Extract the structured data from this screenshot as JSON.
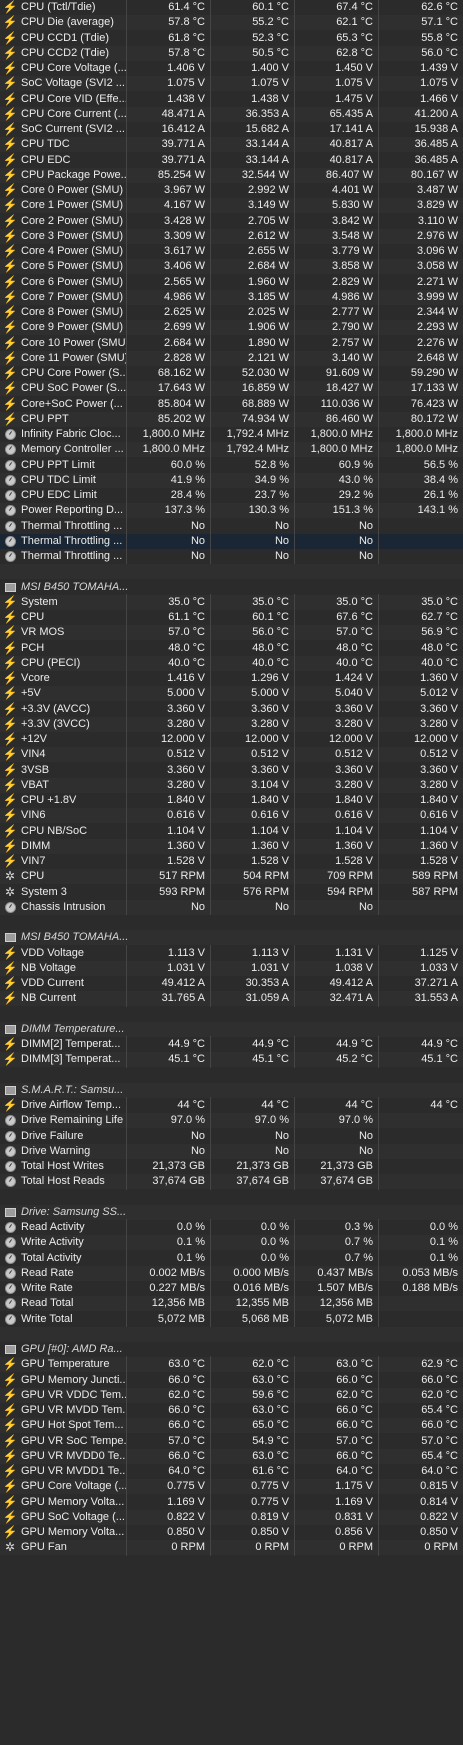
{
  "icons": {
    "bolt": "⚡",
    "fan": "✲"
  },
  "rows": [
    {
      "t": "s",
      "ic": "bolt",
      "n": "CPU (Tctl/Tdie)",
      "v": [
        "61.4 °C",
        "60.1 °C",
        "67.4 °C",
        "62.6 °C"
      ]
    },
    {
      "t": "s",
      "ic": "bolt",
      "n": "CPU Die (average)",
      "v": [
        "57.8 °C",
        "55.2 °C",
        "62.1 °C",
        "57.1 °C"
      ]
    },
    {
      "t": "s",
      "ic": "bolt",
      "n": "CPU CCD1 (Tdie)",
      "v": [
        "61.8 °C",
        "52.3 °C",
        "65.3 °C",
        "55.8 °C"
      ]
    },
    {
      "t": "s",
      "ic": "bolt",
      "n": "CPU CCD2 (Tdie)",
      "v": [
        "57.8 °C",
        "50.5 °C",
        "62.8 °C",
        "56.0 °C"
      ]
    },
    {
      "t": "s",
      "ic": "bolt",
      "n": "CPU Core Voltage (...",
      "v": [
        "1.406 V",
        "1.400 V",
        "1.450 V",
        "1.439 V"
      ]
    },
    {
      "t": "s",
      "ic": "bolt",
      "n": "SoC Voltage (SVI2 ...",
      "v": [
        "1.075 V",
        "1.075 V",
        "1.075 V",
        "1.075 V"
      ]
    },
    {
      "t": "s",
      "ic": "bolt",
      "n": "CPU Core VID (Effe...",
      "v": [
        "1.438 V",
        "1.438 V",
        "1.475 V",
        "1.466 V"
      ]
    },
    {
      "t": "s",
      "ic": "bolt",
      "n": "CPU Core Current (...",
      "v": [
        "48.471 A",
        "36.353 A",
        "65.435 A",
        "41.200 A"
      ]
    },
    {
      "t": "s",
      "ic": "bolt",
      "n": "SoC Current (SVI2 ...",
      "v": [
        "16.412 A",
        "15.682 A",
        "17.141 A",
        "15.938 A"
      ]
    },
    {
      "t": "s",
      "ic": "bolt",
      "n": "CPU TDC",
      "v": [
        "39.771 A",
        "33.144 A",
        "40.817 A",
        "36.485 A"
      ]
    },
    {
      "t": "s",
      "ic": "bolt",
      "n": "CPU EDC",
      "v": [
        "39.771 A",
        "33.144 A",
        "40.817 A",
        "36.485 A"
      ]
    },
    {
      "t": "s",
      "ic": "bolt",
      "n": "CPU Package Powe...",
      "v": [
        "85.254 W",
        "32.544 W",
        "86.407 W",
        "80.167 W"
      ]
    },
    {
      "t": "s",
      "ic": "bolt",
      "n": "Core 0 Power (SMU)",
      "v": [
        "3.967 W",
        "2.992 W",
        "4.401 W",
        "3.487 W"
      ]
    },
    {
      "t": "s",
      "ic": "bolt",
      "n": "Core 1 Power (SMU)",
      "v": [
        "4.167 W",
        "3.149 W",
        "5.830 W",
        "3.829 W"
      ]
    },
    {
      "t": "s",
      "ic": "bolt",
      "n": "Core 2 Power (SMU)",
      "v": [
        "3.428 W",
        "2.705 W",
        "3.842 W",
        "3.110 W"
      ]
    },
    {
      "t": "s",
      "ic": "bolt",
      "n": "Core 3 Power (SMU)",
      "v": [
        "3.309 W",
        "2.612 W",
        "3.548 W",
        "2.976 W"
      ]
    },
    {
      "t": "s",
      "ic": "bolt",
      "n": "Core 4 Power (SMU)",
      "v": [
        "3.617 W",
        "2.655 W",
        "3.779 W",
        "3.096 W"
      ]
    },
    {
      "t": "s",
      "ic": "bolt",
      "n": "Core 5 Power (SMU)",
      "v": [
        "3.406 W",
        "2.684 W",
        "3.858 W",
        "3.058 W"
      ]
    },
    {
      "t": "s",
      "ic": "bolt",
      "n": "Core 6 Power (SMU)",
      "v": [
        "2.565 W",
        "1.960 W",
        "2.829 W",
        "2.271 W"
      ]
    },
    {
      "t": "s",
      "ic": "bolt",
      "n": "Core 7 Power (SMU)",
      "v": [
        "4.986 W",
        "3.185 W",
        "4.986 W",
        "3.999 W"
      ]
    },
    {
      "t": "s",
      "ic": "bolt",
      "n": "Core 8 Power (SMU)",
      "v": [
        "2.625 W",
        "2.025 W",
        "2.777 W",
        "2.344 W"
      ]
    },
    {
      "t": "s",
      "ic": "bolt",
      "n": "Core 9 Power (SMU)",
      "v": [
        "2.699 W",
        "1.906 W",
        "2.790 W",
        "2.293 W"
      ]
    },
    {
      "t": "s",
      "ic": "bolt",
      "n": "Core 10 Power (SMU)",
      "v": [
        "2.684 W",
        "1.890 W",
        "2.757 W",
        "2.276 W"
      ]
    },
    {
      "t": "s",
      "ic": "bolt",
      "n": "Core 11 Power (SMU)",
      "v": [
        "2.828 W",
        "2.121 W",
        "3.140 W",
        "2.648 W"
      ]
    },
    {
      "t": "s",
      "ic": "bolt",
      "n": "CPU Core Power (S...",
      "v": [
        "68.162 W",
        "52.030 W",
        "91.609 W",
        "59.290 W"
      ]
    },
    {
      "t": "s",
      "ic": "bolt",
      "n": "CPU SoC Power (S...",
      "v": [
        "17.643 W",
        "16.859 W",
        "18.427 W",
        "17.133 W"
      ]
    },
    {
      "t": "s",
      "ic": "bolt",
      "n": "Core+SoC Power (...",
      "v": [
        "85.804 W",
        "68.889 W",
        "110.036 W",
        "76.423 W"
      ]
    },
    {
      "t": "s",
      "ic": "bolt",
      "n": "CPU PPT",
      "v": [
        "85.202 W",
        "74.934 W",
        "86.460 W",
        "80.172 W"
      ]
    },
    {
      "t": "s",
      "ic": "gauge",
      "n": "Infinity Fabric Cloc...",
      "v": [
        "1,800.0 MHz",
        "1,792.4 MHz",
        "1,800.0 MHz",
        "1,800.0 MHz"
      ]
    },
    {
      "t": "s",
      "ic": "gauge",
      "n": "Memory Controller ...",
      "v": [
        "1,800.0 MHz",
        "1,792.4 MHz",
        "1,800.0 MHz",
        "1,800.0 MHz"
      ]
    },
    {
      "t": "s",
      "ic": "gauge",
      "n": "CPU PPT Limit",
      "v": [
        "60.0 %",
        "52.8 %",
        "60.9 %",
        "56.5 %"
      ]
    },
    {
      "t": "s",
      "ic": "gauge",
      "n": "CPU TDC Limit",
      "v": [
        "41.9 %",
        "34.9 %",
        "43.0 %",
        "38.4 %"
      ]
    },
    {
      "t": "s",
      "ic": "gauge",
      "n": "CPU EDC Limit",
      "v": [
        "28.4 %",
        "23.7 %",
        "29.2 %",
        "26.1 %"
      ]
    },
    {
      "t": "s",
      "ic": "gauge",
      "n": "Power Reporting D...",
      "v": [
        "137.3 %",
        "130.3 %",
        "151.3 %",
        "143.1 %"
      ]
    },
    {
      "t": "s",
      "ic": "gauge",
      "n": "Thermal Throttling ...",
      "v": [
        "No",
        "No",
        "No",
        ""
      ]
    },
    {
      "t": "s",
      "ic": "gauge",
      "n": "Thermal Throttling ...",
      "v": [
        "No",
        "No",
        "No",
        ""
      ],
      "sel": true
    },
    {
      "t": "s",
      "ic": "gauge",
      "n": "Thermal Throttling ...",
      "v": [
        "No",
        "No",
        "No",
        ""
      ]
    },
    {
      "t": "b"
    },
    {
      "t": "h",
      "n": "MSI B450 TOMAHA..."
    },
    {
      "t": "s",
      "ic": "bolt",
      "n": "System",
      "v": [
        "35.0 °C",
        "35.0 °C",
        "35.0 °C",
        "35.0 °C"
      ]
    },
    {
      "t": "s",
      "ic": "bolt",
      "n": "CPU",
      "v": [
        "61.1 °C",
        "60.1 °C",
        "67.6 °C",
        "62.7 °C"
      ]
    },
    {
      "t": "s",
      "ic": "bolt",
      "n": "VR MOS",
      "v": [
        "57.0 °C",
        "56.0 °C",
        "57.0 °C",
        "56.9 °C"
      ]
    },
    {
      "t": "s",
      "ic": "bolt",
      "n": "PCH",
      "v": [
        "48.0 °C",
        "48.0 °C",
        "48.0 °C",
        "48.0 °C"
      ]
    },
    {
      "t": "s",
      "ic": "bolt",
      "n": "CPU (PECI)",
      "v": [
        "40.0 °C",
        "40.0 °C",
        "40.0 °C",
        "40.0 °C"
      ]
    },
    {
      "t": "s",
      "ic": "bolt",
      "n": "Vcore",
      "v": [
        "1.416 V",
        "1.296 V",
        "1.424 V",
        "1.360 V"
      ]
    },
    {
      "t": "s",
      "ic": "bolt",
      "n": "+5V",
      "v": [
        "5.000 V",
        "5.000 V",
        "5.040 V",
        "5.012 V"
      ]
    },
    {
      "t": "s",
      "ic": "bolt",
      "n": "+3.3V (AVCC)",
      "v": [
        "3.360 V",
        "3.360 V",
        "3.360 V",
        "3.360 V"
      ]
    },
    {
      "t": "s",
      "ic": "bolt",
      "n": "+3.3V (3VCC)",
      "v": [
        "3.280 V",
        "3.280 V",
        "3.280 V",
        "3.280 V"
      ]
    },
    {
      "t": "s",
      "ic": "bolt",
      "n": "+12V",
      "v": [
        "12.000 V",
        "12.000 V",
        "12.000 V",
        "12.000 V"
      ]
    },
    {
      "t": "s",
      "ic": "bolt",
      "n": "VIN4",
      "v": [
        "0.512 V",
        "0.512 V",
        "0.512 V",
        "0.512 V"
      ]
    },
    {
      "t": "s",
      "ic": "bolt",
      "n": "3VSB",
      "v": [
        "3.360 V",
        "3.360 V",
        "3.360 V",
        "3.360 V"
      ]
    },
    {
      "t": "s",
      "ic": "bolt",
      "n": "VBAT",
      "v": [
        "3.280 V",
        "3.104 V",
        "3.280 V",
        "3.280 V"
      ]
    },
    {
      "t": "s",
      "ic": "bolt",
      "n": "CPU +1.8V",
      "v": [
        "1.840 V",
        "1.840 V",
        "1.840 V",
        "1.840 V"
      ]
    },
    {
      "t": "s",
      "ic": "bolt",
      "n": "VIN6",
      "v": [
        "0.616 V",
        "0.616 V",
        "0.616 V",
        "0.616 V"
      ]
    },
    {
      "t": "s",
      "ic": "bolt",
      "n": "CPU NB/SoC",
      "v": [
        "1.104 V",
        "1.104 V",
        "1.104 V",
        "1.104 V"
      ]
    },
    {
      "t": "s",
      "ic": "bolt",
      "n": "DIMM",
      "v": [
        "1.360 V",
        "1.360 V",
        "1.360 V",
        "1.360 V"
      ]
    },
    {
      "t": "s",
      "ic": "bolt",
      "n": "VIN7",
      "v": [
        "1.528 V",
        "1.528 V",
        "1.528 V",
        "1.528 V"
      ]
    },
    {
      "t": "s",
      "ic": "fan",
      "n": "CPU",
      "v": [
        "517 RPM",
        "504 RPM",
        "709 RPM",
        "589 RPM"
      ]
    },
    {
      "t": "s",
      "ic": "fan",
      "n": "System 3",
      "v": [
        "593 RPM",
        "576 RPM",
        "594 RPM",
        "587 RPM"
      ]
    },
    {
      "t": "s",
      "ic": "gauge",
      "n": "Chassis Intrusion",
      "v": [
        "No",
        "No",
        "No",
        ""
      ]
    },
    {
      "t": "b"
    },
    {
      "t": "h",
      "n": "MSI B450 TOMAHA..."
    },
    {
      "t": "s",
      "ic": "bolt",
      "n": "VDD Voltage",
      "v": [
        "1.113 V",
        "1.113 V",
        "1.131 V",
        "1.125 V"
      ]
    },
    {
      "t": "s",
      "ic": "bolt",
      "n": "NB Voltage",
      "v": [
        "1.031 V",
        "1.031 V",
        "1.038 V",
        "1.033 V"
      ]
    },
    {
      "t": "s",
      "ic": "bolt",
      "n": "VDD Current",
      "v": [
        "49.412 A",
        "30.353 A",
        "49.412 A",
        "37.271 A"
      ]
    },
    {
      "t": "s",
      "ic": "bolt",
      "n": "NB Current",
      "v": [
        "31.765 A",
        "31.059 A",
        "32.471 A",
        "31.553 A"
      ]
    },
    {
      "t": "b"
    },
    {
      "t": "h",
      "n": "DIMM Temperature..."
    },
    {
      "t": "s",
      "ic": "bolt",
      "n": "DIMM[2] Temperat...",
      "v": [
        "44.9 °C",
        "44.9 °C",
        "44.9 °C",
        "44.9 °C"
      ]
    },
    {
      "t": "s",
      "ic": "bolt",
      "n": "DIMM[3] Temperat...",
      "v": [
        "45.1 °C",
        "45.1 °C",
        "45.2 °C",
        "45.1 °C"
      ]
    },
    {
      "t": "b"
    },
    {
      "t": "h",
      "n": "S.M.A.R.T.: Samsu..."
    },
    {
      "t": "s",
      "ic": "bolt",
      "n": "Drive Airflow Temp...",
      "v": [
        "44 °C",
        "44 °C",
        "44 °C",
        "44 °C"
      ]
    },
    {
      "t": "s",
      "ic": "gauge",
      "n": "Drive Remaining Life",
      "v": [
        "97.0 %",
        "97.0 %",
        "97.0 %",
        ""
      ]
    },
    {
      "t": "s",
      "ic": "gauge",
      "n": "Drive Failure",
      "v": [
        "No",
        "No",
        "No",
        ""
      ]
    },
    {
      "t": "s",
      "ic": "gauge",
      "n": "Drive Warning",
      "v": [
        "No",
        "No",
        "No",
        ""
      ]
    },
    {
      "t": "s",
      "ic": "gauge",
      "n": "Total Host Writes",
      "v": [
        "21,373 GB",
        "21,373 GB",
        "21,373 GB",
        ""
      ]
    },
    {
      "t": "s",
      "ic": "gauge",
      "n": "Total Host Reads",
      "v": [
        "37,674 GB",
        "37,674 GB",
        "37,674 GB",
        ""
      ]
    },
    {
      "t": "b"
    },
    {
      "t": "h",
      "n": "Drive: Samsung SS..."
    },
    {
      "t": "s",
      "ic": "gauge",
      "n": "Read Activity",
      "v": [
        "0.0 %",
        "0.0 %",
        "0.3 %",
        "0.0 %"
      ]
    },
    {
      "t": "s",
      "ic": "gauge",
      "n": "Write Activity",
      "v": [
        "0.1 %",
        "0.0 %",
        "0.7 %",
        "0.1 %"
      ]
    },
    {
      "t": "s",
      "ic": "gauge",
      "n": "Total Activity",
      "v": [
        "0.1 %",
        "0.0 %",
        "0.7 %",
        "0.1 %"
      ]
    },
    {
      "t": "s",
      "ic": "gauge",
      "n": "Read Rate",
      "v": [
        "0.002 MB/s",
        "0.000 MB/s",
        "0.437 MB/s",
        "0.053 MB/s"
      ]
    },
    {
      "t": "s",
      "ic": "gauge",
      "n": "Write Rate",
      "v": [
        "0.227 MB/s",
        "0.016 MB/s",
        "1.507 MB/s",
        "0.188 MB/s"
      ]
    },
    {
      "t": "s",
      "ic": "gauge",
      "n": "Read Total",
      "v": [
        "12,356 MB",
        "12,355 MB",
        "12,356 MB",
        ""
      ]
    },
    {
      "t": "s",
      "ic": "gauge",
      "n": "Write Total",
      "v": [
        "5,072 MB",
        "5,068 MB",
        "5,072 MB",
        ""
      ]
    },
    {
      "t": "b"
    },
    {
      "t": "h",
      "n": "GPU [#0]: AMD Ra..."
    },
    {
      "t": "s",
      "ic": "bolt",
      "n": "GPU Temperature",
      "v": [
        "63.0 °C",
        "62.0 °C",
        "63.0 °C",
        "62.9 °C"
      ]
    },
    {
      "t": "s",
      "ic": "bolt",
      "n": "GPU Memory Juncti...",
      "v": [
        "66.0 °C",
        "63.0 °C",
        "66.0 °C",
        "66.0 °C"
      ]
    },
    {
      "t": "s",
      "ic": "bolt",
      "n": "GPU VR VDDC Tem...",
      "v": [
        "62.0 °C",
        "59.6 °C",
        "62.0 °C",
        "62.0 °C"
      ]
    },
    {
      "t": "s",
      "ic": "bolt",
      "n": "GPU VR MVDD Tem...",
      "v": [
        "66.0 °C",
        "63.0 °C",
        "66.0 °C",
        "65.4 °C"
      ]
    },
    {
      "t": "s",
      "ic": "bolt",
      "n": "GPU Hot Spot Tem...",
      "v": [
        "66.0 °C",
        "65.0 °C",
        "66.0 °C",
        "66.0 °C"
      ]
    },
    {
      "t": "s",
      "ic": "bolt",
      "n": "GPU VR SoC Tempe...",
      "v": [
        "57.0 °C",
        "54.9 °C",
        "57.0 °C",
        "57.0 °C"
      ]
    },
    {
      "t": "s",
      "ic": "bolt",
      "n": "GPU VR MVDD0 Te...",
      "v": [
        "66.0 °C",
        "63.0 °C",
        "66.0 °C",
        "65.4 °C"
      ]
    },
    {
      "t": "s",
      "ic": "bolt",
      "n": "GPU VR MVDD1 Te...",
      "v": [
        "64.0 °C",
        "61.6 °C",
        "64.0 °C",
        "64.0 °C"
      ]
    },
    {
      "t": "s",
      "ic": "bolt",
      "n": "GPU Core Voltage (...",
      "v": [
        "0.775 V",
        "0.775 V",
        "1.175 V",
        "0.815 V"
      ]
    },
    {
      "t": "s",
      "ic": "bolt",
      "n": "GPU Memory Volta...",
      "v": [
        "1.169 V",
        "0.775 V",
        "1.169 V",
        "0.814 V"
      ]
    },
    {
      "t": "s",
      "ic": "bolt",
      "n": "GPU SoC Voltage (...",
      "v": [
        "0.822 V",
        "0.819 V",
        "0.831 V",
        "0.822 V"
      ]
    },
    {
      "t": "s",
      "ic": "bolt",
      "n": "GPU Memory Volta...",
      "v": [
        "0.850 V",
        "0.850 V",
        "0.856 V",
        "0.850 V"
      ]
    },
    {
      "t": "s",
      "ic": "fan",
      "n": "GPU Fan",
      "v": [
        "0 RPM",
        "0 RPM",
        "0 RPM",
        "0 RPM"
      ]
    }
  ]
}
